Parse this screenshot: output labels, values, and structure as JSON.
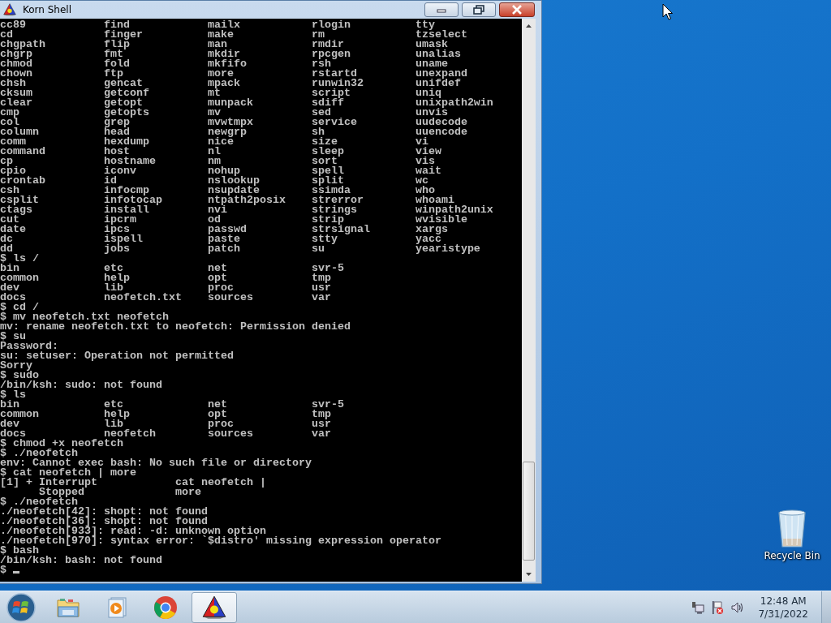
{
  "window": {
    "title": "Korn Shell"
  },
  "terminal": {
    "lines": [
      "cc89\tfind\tmailx\trlogin\ttty",
      "cd\tfinger\tmake\trm\ttzselect",
      "chgpath\tflip\tman\trmdir\tumask",
      "chgrp\tfmt\tmkdir\trpcgen\tunalias",
      "chmod\tfold\tmkfifo\trsh\tuname",
      "chown\tftp\tmore\trstartd\tunexpand",
      "chsh\tgencat\tmpack\trunwin32\tunifdef",
      "cksum\tgetconf\tmt\tscript\tuniq",
      "clear\tgetopt\tmunpack\tsdiff\tunixpath2win",
      "cmp\tgetopts\tmv\tsed\tunvis",
      "col\tgrep\tmvwtmpx\tservice\tuudecode",
      "column\thead\tnewgrp\tsh\tuuencode",
      "comm\thexdump\tnice\tsize\tvi",
      "command\thost\tnl\tsleep\tview",
      "cp\thostname\tnm\tsort\tvis",
      "cpio\ticonv\tnohup\tspell\twait",
      "crontab\tid\tnslookup\tsplit\twc",
      "csh\tinfocmp\tnsupdate\tssimda\twho",
      "csplit\tinfotocap\tntpath2posix\tstrerror\twhoami",
      "ctags\tinstall\tnvi\tstrings\twinpath2unix",
      "cut\tipcrm\tod\tstrip\twvisible",
      "date\tipcs\tpasswd\tstrsignal\txargs",
      "dc\tispell\tpaste\tstty\tyacc",
      "dd\tjobs\tpatch\tsu\tyearistype",
      "$ ls /",
      "bin\tetc\tnet\tsvr-5",
      "common\thelp\topt\ttmp",
      "dev\tlib\tproc\tusr",
      "docs\tneofetch.txt\tsources\tvar",
      "$ cd /",
      "$ mv neofetch.txt neofetch",
      "mv: rename neofetch.txt to neofetch: Permission denied",
      "$ su",
      "Password:",
      "su: setuser: Operation not permitted",
      "Sorry",
      "$ sudo",
      "/bin/ksh: sudo: not found",
      "$ ls",
      "bin\tetc\tnet\tsvr-5",
      "common\thelp\topt\ttmp",
      "dev\tlib\tproc\tusr",
      "docs\tneofetch\tsources\tvar",
      "$ chmod +x neofetch",
      "$ ./neofetch",
      "env: Cannot exec bash: No such file or directory",
      "$ cat neofetch | more",
      "[1] + Interrupt            cat neofetch |",
      "      Stopped              more",
      "$ ./neofetch",
      "./neofetch[42]: shopt: not found",
      "./neofetch[36]: shopt: not found",
      "./neofetch[933]: read: -d: unknown option",
      "./neofetch[970]: syntax error: `$distro' missing expression operator",
      "$ bash",
      "/bin/ksh: bash: not found",
      "$"
    ]
  },
  "desktop_icons": [
    {
      "label": "Recycle Bin"
    }
  ],
  "taskbar": {
    "items": [
      {
        "kind": "folder",
        "selected": false
      },
      {
        "kind": "media",
        "selected": false
      },
      {
        "kind": "browser",
        "selected": false
      },
      {
        "kind": "shell",
        "selected": true
      }
    ]
  },
  "clock": {
    "time": "12:48 AM",
    "date": "7/31/2022"
  }
}
